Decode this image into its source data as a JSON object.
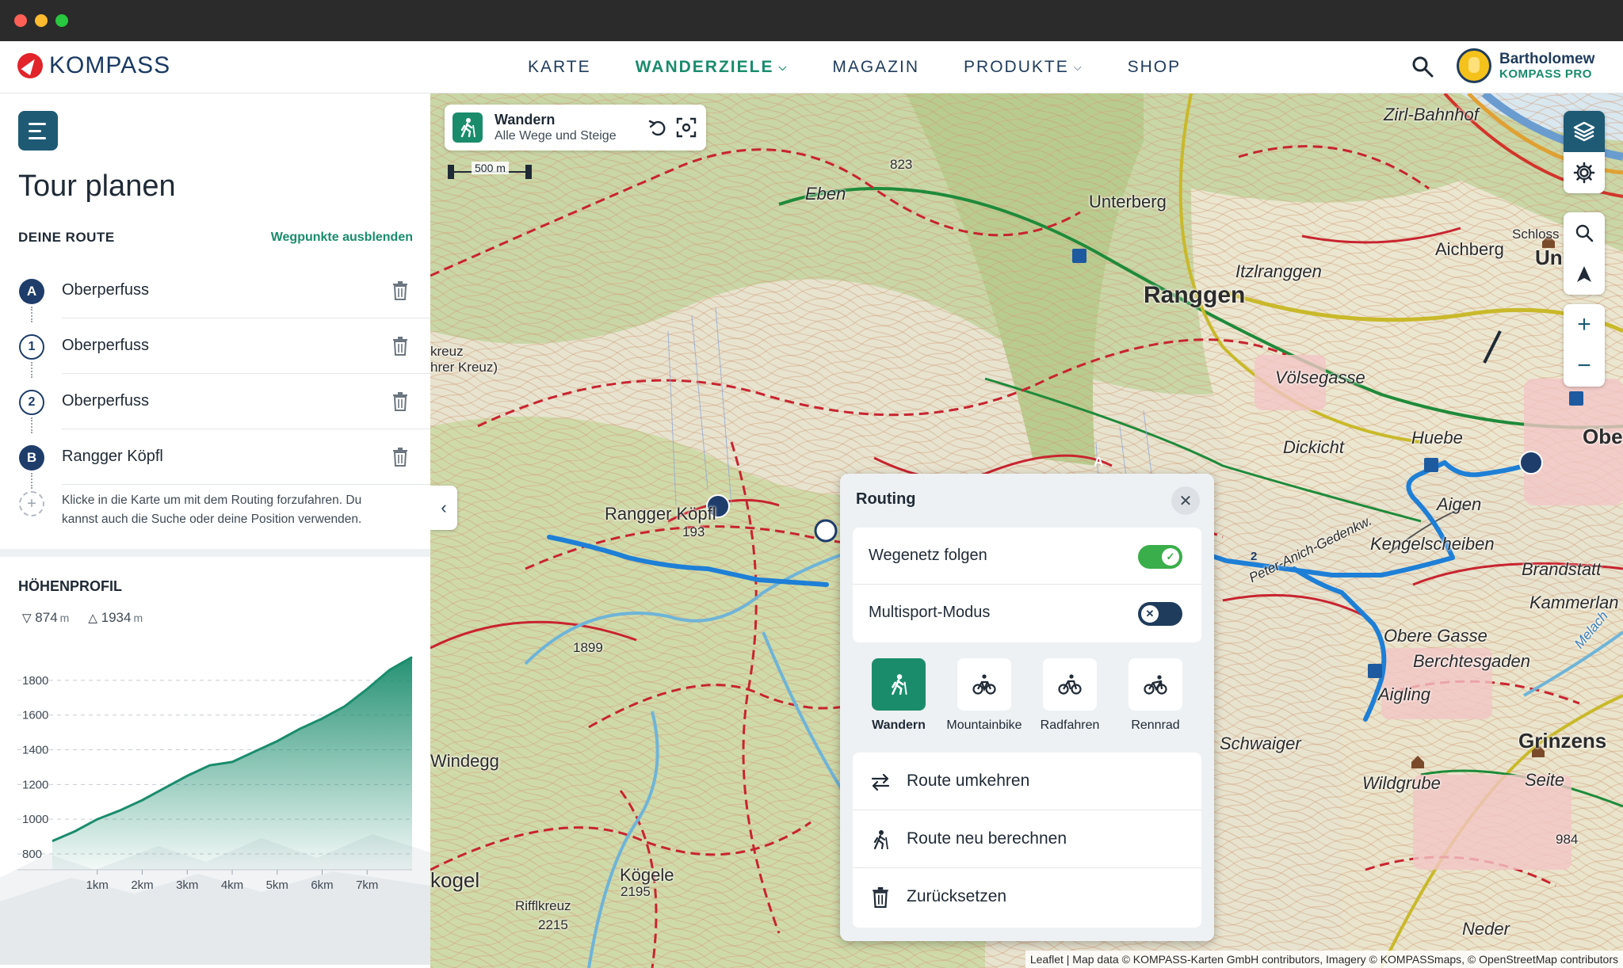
{
  "nav": {
    "logo_text": "KOMPASS",
    "links": [
      {
        "label": "KARTE",
        "dropdown": false,
        "active": false
      },
      {
        "label": "WANDERZIELE",
        "dropdown": true,
        "active": true
      },
      {
        "label": "MAGAZIN",
        "dropdown": false,
        "active": false
      },
      {
        "label": "PRODUKTE",
        "dropdown": true,
        "active": false
      },
      {
        "label": "SHOP",
        "dropdown": false,
        "active": false
      }
    ],
    "user_name": "Bartholomew",
    "user_tier": "KOMPASS PRO"
  },
  "sidebar": {
    "title": "Tour planen",
    "route_heading": "DEINE ROUTE",
    "hide_waypoints": "Wegpunkte ausblenden",
    "waypoints": [
      {
        "badge": "A",
        "name": "Oberperfuss",
        "style": "solid"
      },
      {
        "badge": "1",
        "name": "Oberperfuss",
        "style": "ring"
      },
      {
        "badge": "2",
        "name": "Oberperfuss",
        "style": "ring"
      },
      {
        "badge": "B",
        "name": "Rangger Köpfl",
        "style": "solid"
      }
    ],
    "hint": "Klicke in die Karte um mit dem Routing forzufahren. Du kannst auch die Suche oder deine Position verwenden.",
    "elevation_heading": "HÖHENPROFIL",
    "elevation_min": "874",
    "elevation_max": "1934",
    "elevation_unit": "m"
  },
  "chart_data": {
    "type": "area",
    "x": [
      0,
      0.5,
      1,
      1.5,
      2,
      2.5,
      3,
      3.5,
      4,
      4.5,
      5,
      5.5,
      6,
      6.5,
      7,
      7.5,
      8
    ],
    "values": [
      874,
      930,
      1000,
      1050,
      1110,
      1180,
      1250,
      1310,
      1330,
      1390,
      1450,
      1520,
      1580,
      1650,
      1750,
      1860,
      1934
    ],
    "xlabel": "",
    "ylabel": "",
    "x_ticks": [
      "1km",
      "2km",
      "3km",
      "4km",
      "5km",
      "6km",
      "7km"
    ],
    "y_ticks": [
      "800",
      "1000",
      "1200",
      "1400",
      "1600",
      "1800"
    ],
    "ylim": [
      800,
      1950
    ],
    "xlim": [
      0,
      8
    ],
    "color": "#1a8c6c",
    "grid": "horizontal dashed"
  },
  "map": {
    "mode_title": "Wandern",
    "mode_subtitle": "Alle Wege und Steige",
    "scale": "500 m",
    "labels": {
      "ranggen": "Ranggen",
      "unterberg": "Unterberg",
      "eben": "Eben",
      "aichberg": "Aichberg",
      "itzlranggen": "Itzlranggen",
      "voelsegasse": "Völsegasse",
      "dickicht": "Dickicht",
      "huebe": "Huebe",
      "aigen": "Aigen",
      "kengelscheiben": "Kengelscheiben",
      "brandstatt": "Brandstatt",
      "kammerlan": "Kammerlan",
      "obere_gasse": "Obere Gasse",
      "berchtesgaden": "Berchtesgaden",
      "aigling": "Aigling",
      "schwaiger": "Schwaiger",
      "wildgrube": "Wildgrube",
      "seite": "Seite",
      "grinzens": "Grinzens",
      "rangger_koepfl": "Rangger Köpfl",
      "koepfl_height": "193",
      "kogele": "Kögele",
      "kogele_height": "2195",
      "rifflkreuz": "Rifflkreuz",
      "rifflkreuz_height": "2215",
      "windegg": "Windegg",
      "kogel": "kogel",
      "neder": "Neder",
      "zirl_bahnhof": "Zirl-Bahnhof",
      "schloss": "Schloss F",
      "un": "Un",
      "obe": "Obe",
      "kreuz": "kreuz",
      "hrer_kreuz": "hrer Kreuz)",
      "h823": "823",
      "h1899": "1899",
      "h984": "984",
      "peter_anich": "Peter-Anich-Gedenkw.",
      "melach": "Melach",
      "marker_a": "A",
      "marker_b": "B",
      "marker_2": "2"
    },
    "attribution": "Leaflet | Map data © KOMPASS-Karten GmbH contributors, Imagery © KOMPASSmaps, © OpenStreetMap contributors"
  },
  "routing": {
    "title": "Routing",
    "toggles": [
      {
        "label": "Wegenetz folgen",
        "on": true
      },
      {
        "label": "Multisport-Modus",
        "on": false
      }
    ],
    "sports": [
      {
        "label": "Wandern",
        "icon": "hiking-icon",
        "active": true
      },
      {
        "label": "Mountainbike",
        "icon": "mountainbike-icon",
        "active": false
      },
      {
        "label": "Radfahren",
        "icon": "bicycle-icon",
        "active": false
      },
      {
        "label": "Rennrad",
        "icon": "racebike-icon",
        "active": false
      }
    ],
    "actions": [
      {
        "label": "Route umkehren",
        "icon": "swap-icon"
      },
      {
        "label": "Route neu berechnen",
        "icon": "hiking-recalc-icon"
      },
      {
        "label": "Zurücksetzen",
        "icon": "trash-icon"
      }
    ]
  },
  "colors": {
    "accent": "#1a8c6c",
    "navy": "#1e3d6b",
    "route": "#1e7fd6",
    "trail_red": "#c8242f"
  }
}
